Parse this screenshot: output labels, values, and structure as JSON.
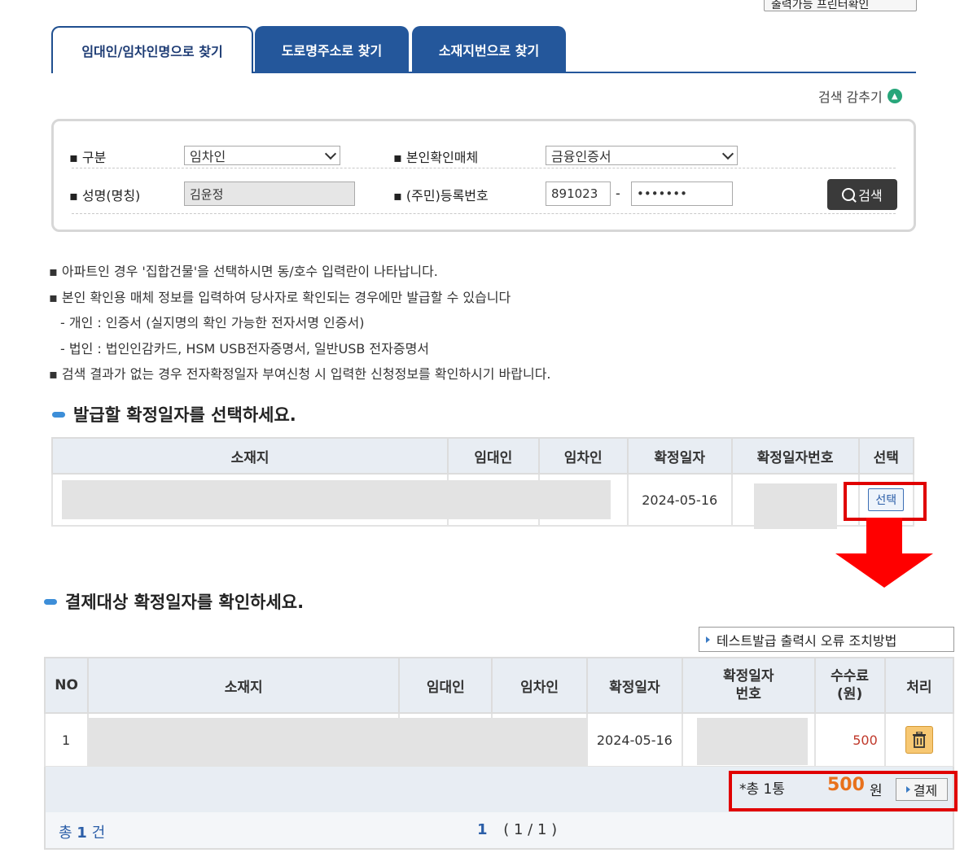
{
  "top": {
    "printer_button": "출력가능 프린터확인"
  },
  "tabs": [
    {
      "label": "임대인/임차인명으로 찾기"
    },
    {
      "label": "도로명주소로 찾기"
    },
    {
      "label": "소재지번으로 찾기"
    }
  ],
  "search_toggle": {
    "label": "검색 감추기",
    "icon": "chevron-up-icon"
  },
  "form": {
    "type_label": "▪ 구분",
    "type_value": "임차인",
    "media_label": "▪ 본인확인매체",
    "media_value": "금융인증서",
    "name_label": "▪ 성명(명칭)",
    "name_value": "김윤정",
    "regno_label": "▪ (주민)등록번호",
    "regno_front": "891023",
    "regno_sep": "-",
    "regno_back": "•••••••",
    "search_button": "검색"
  },
  "notes": [
    "▪ 아파트인 경우 '집합건물'을 선택하시면 동/호수 입력란이 나타납니다.",
    "▪ 본인 확인용 매체 정보를 입력하여 당사자로 확인되는 경우에만 발급할 수 있습니다",
    "  - 개인 : 인증서 (실지명의 확인 가능한 전자서명 인증서)",
    "  - 법인 : 법인인감카드, HSM USB전자증명서, 일반USB 전자증명서",
    "▪ 검색 결과가 없는 경우 전자확정일자 부여신청 시 입력한 신청정보를 확인하시기 바랍니다."
  ],
  "section1": {
    "title": "발급할 확정일자를 선택하세요.",
    "headers": [
      "소재지",
      "임대인",
      "임차인",
      "확정일자",
      "확정일자번호",
      "선택"
    ],
    "rows": [
      {
        "date": "2024-05-16",
        "select_label": "선택"
      }
    ]
  },
  "section2": {
    "title": "결제대상 확정일자를 확인하세요.",
    "error_button": "테스트발급 출력시 오류 조치방법",
    "headers": [
      "NO",
      "소재지",
      "임대인",
      "임차인",
      "확정일자",
      "확정일자\n번호",
      "수수료\n(원)",
      "처리"
    ],
    "rows": [
      {
        "no": "1",
        "date": "2024-05-16",
        "fee": "500"
      }
    ],
    "summary": {
      "count_text": "*총 1통",
      "amount": "500",
      "unit": "원",
      "pay_button": "결제"
    },
    "footer": {
      "total_prefix": "총",
      "total_count": "1",
      "total_suffix": "건",
      "page_current": "1",
      "page_info": "( 1 / 1 )"
    }
  },
  "colors": {
    "tab_blue": "#24579b",
    "highlight_red": "#e00000",
    "fee_red": "#c0392b",
    "amount_orange": "#e8711c"
  }
}
